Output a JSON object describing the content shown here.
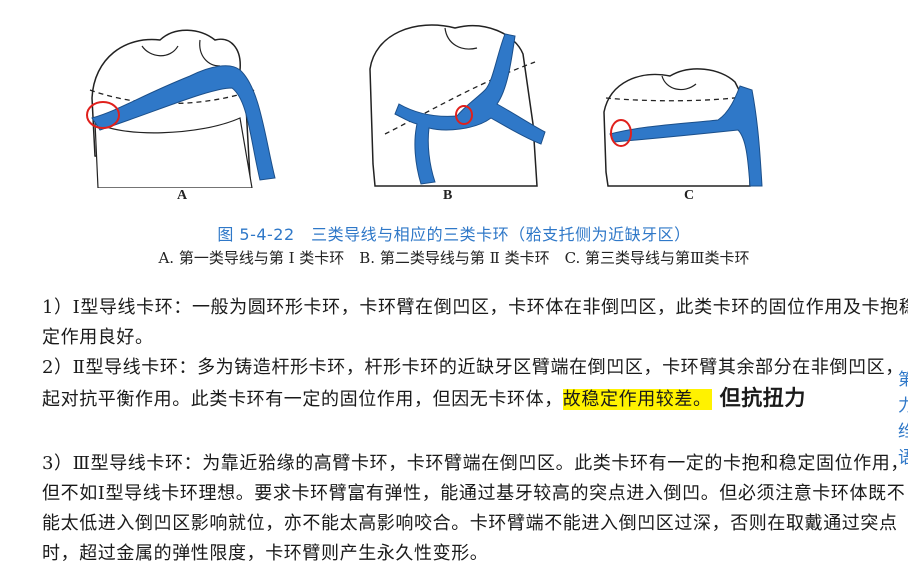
{
  "figure": {
    "labels": [
      "A",
      "B",
      "C"
    ],
    "caption": "图 5-4-22　三类导线与相应的三类卡环（𬌗支托侧为近缺牙区）",
    "subcaption": "A. 第一类导线与第 Ⅰ 类卡环　B. 第二类导线与第 Ⅱ 类卡环　C. 第三类导线与第Ⅲ类卡环"
  },
  "paragraphs": {
    "p1": "1）Ⅰ型导线卡环：一般为圆环形卡环，卡环臂在倒凹区，卡环体在非倒凹区，此类卡环的固位作用及卡抱稳定作用良好。",
    "p2_before": "2）Ⅱ型导线卡环：多为铸造杆形卡环，杆形卡环的近缺牙区臂端在倒凹区，卡环臂其余部分在非倒凹区，起对抗平衡作用。此类卡环有一定的固位作用，但因无卡环体，",
    "p2_highlight": "故稳定作用较差。",
    "p2_note": "但抗扭力",
    "p3": "3）Ⅲ型导线卡环：为靠近𬌗缘的高臂卡环，卡环臂端在倒凹区。此类卡环有一定的卡抱和稳定固位作用，但不如Ⅰ型导线卡环理想。要求卡环臂富有弹性，能通过基牙较高的突点进入倒凹。但必须注意卡环体既不能太低进入倒凹区影响就位，亦不能太高影响咬合。卡环臂端不能进入倒凹区过深，否则在取戴通过突点时，超过金属的弹性限度，卡环臂则产生永久性变形。"
  },
  "edge_fragments": [
    "第",
    "力",
    "绉",
    "语"
  ],
  "colors": {
    "clasp_blue": "#2f78c8",
    "highlight": "#fff200",
    "annotation_red": "#e0201c"
  }
}
